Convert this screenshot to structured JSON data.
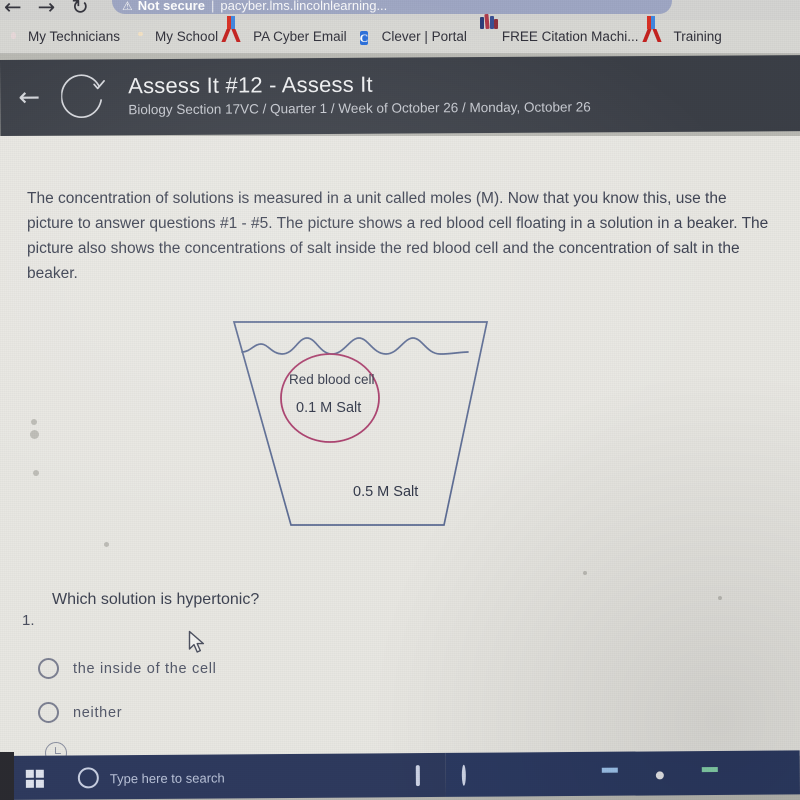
{
  "browser": {
    "nav": {
      "back_icon": "arrow-left-icon",
      "forward_icon": "arrow-right-icon",
      "reload_icon": "reload-icon",
      "back_glyph": "←",
      "forward_glyph": "→",
      "reload_glyph": "↻"
    },
    "omnibox": {
      "warning_icon": "warning-triangle-icon",
      "warning_glyph": "⚠",
      "security_label": "Not secure",
      "separator": "|",
      "url": "pacyber.lms.lincolnlearning..."
    },
    "bookmarks": [
      {
        "label": "My Technicians",
        "icon": "shield-icon"
      },
      {
        "label": "My School",
        "icon": "map-pin-icon"
      },
      {
        "label": "PA Cyber Email",
        "icon": "gmail-icon"
      },
      {
        "label": "Clever | Portal",
        "icon": "clever-icon",
        "letter": "C"
      },
      {
        "label": "FREE Citation Machi...",
        "icon": "books-icon"
      },
      {
        "label": "Training",
        "icon": "gmail-icon"
      }
    ]
  },
  "app_header": {
    "back_icon": "back-arrow-icon",
    "back_glyph": "←",
    "status_icon": "assessment-circle-check-icon",
    "title": "Assess It #12 - Assess It",
    "subtitle": "Biology Section 17VC / Quarter 1 / Week of October 26 / Monday, October 26",
    "bar_color": "#3b3f47"
  },
  "lesson": {
    "intro": "The concentration of solutions is measured in a unit called moles (M).  Now that you know this, use the picture to answer questions #1 - #5.  The picture shows a red blood cell floating in a solution in a beaker.  The picture also shows the concentrations of salt inside the red blood cell and the concentration of salt in the beaker."
  },
  "figure": {
    "name": "beaker-diagram",
    "beaker_outline_color": "#5b6b93",
    "cell_outline_color": "#a93b6a",
    "water_line_icon": "wavy-water-line-icon",
    "cell_label": "Red blood cell",
    "cell_concentration": "0.1 M Salt",
    "beaker_concentration": "0.5 M Salt"
  },
  "question": {
    "number": "1.",
    "text": "Which solution is hypertonic?",
    "choices": [
      {
        "label": "the inside of the cell",
        "selected": false
      },
      {
        "label": "neither",
        "selected": false
      }
    ]
  },
  "page_footer": {
    "timer_icon": "clock-icon"
  },
  "cursor": {
    "icon": "mouse-pointer-icon"
  },
  "taskbar": {
    "start_icon": "windows-start-icon",
    "search_icon": "search-circle-icon",
    "search_placeholder": "Type here to search",
    "items": [
      {
        "icon": "task-view-icon"
      },
      {
        "icon": "cortana-icon"
      },
      {
        "icon": "file-explorer-icon"
      },
      {
        "icon": "paint-icon"
      },
      {
        "icon": "word-icon"
      },
      {
        "icon": "chrome-icon"
      },
      {
        "icon": "excel-icon"
      }
    ]
  }
}
